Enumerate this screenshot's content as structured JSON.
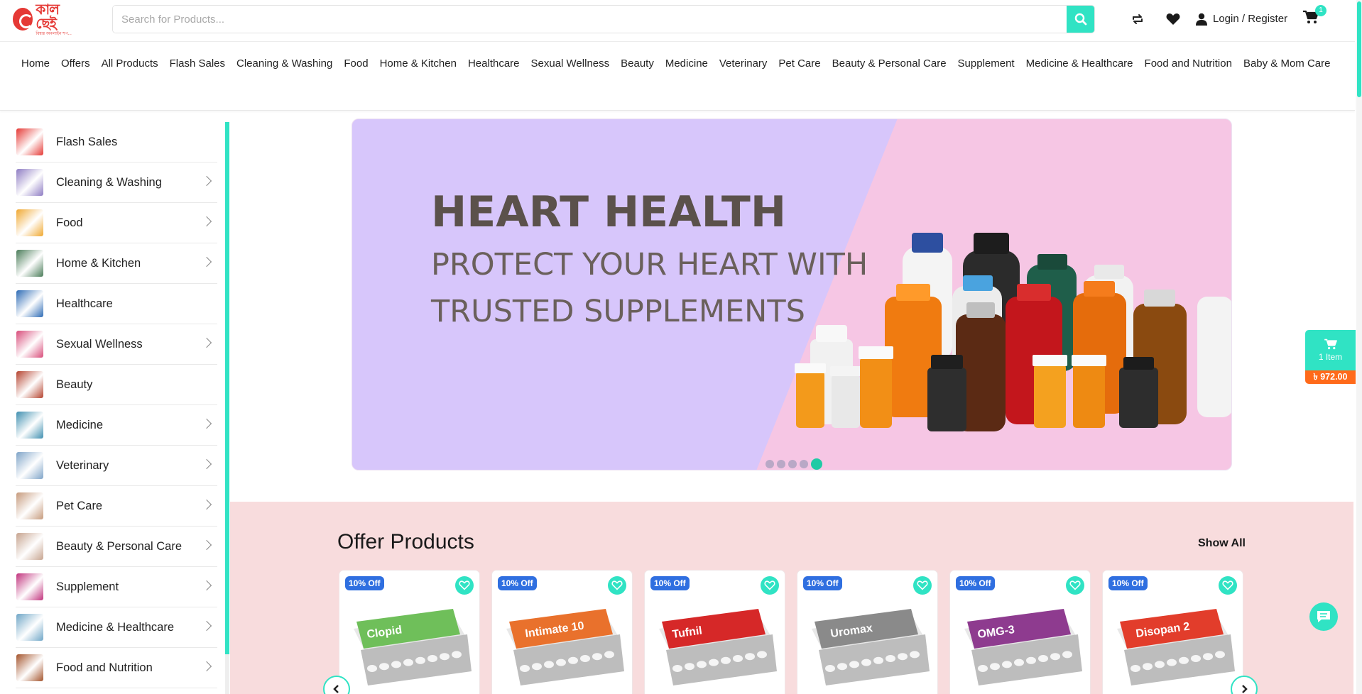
{
  "header": {
    "logo_text": "কাল ছেই",
    "logo_tagline": "বিশ্বস্ত অনলাইন শপ...",
    "search_placeholder": "Search for Products...",
    "login_label": "Login / Register",
    "cart_count": "1",
    "icons": [
      "compare-icon",
      "heart-icon",
      "user-icon",
      "cart-icon",
      "search-icon"
    ]
  },
  "nav": {
    "items": [
      "Home",
      "Offers",
      "All Products",
      "Flash Sales",
      "Cleaning & Washing",
      "Food",
      "Home & Kitchen",
      "Healthcare",
      "Sexual Wellness",
      "Beauty",
      "Medicine",
      "Veterinary",
      "Pet Care",
      "Beauty & Personal Care",
      "Supplement",
      "Medicine & Healthcare",
      "Food and Nutrition",
      "Baby & Mom Care"
    ]
  },
  "sidebar": {
    "items": [
      {
        "label": "Flash Sales",
        "has_children": false,
        "color": "#e53935"
      },
      {
        "label": "Cleaning & Washing",
        "has_children": true,
        "color": "#8e7cc3"
      },
      {
        "label": "Food",
        "has_children": true,
        "color": "#f0a830"
      },
      {
        "label": "Home & Kitchen",
        "has_children": true,
        "color": "#4a7c59"
      },
      {
        "label": "Healthcare",
        "has_children": false,
        "color": "#2d6bb5"
      },
      {
        "label": "Sexual Wellness",
        "has_children": true,
        "color": "#d84c7a"
      },
      {
        "label": "Beauty",
        "has_children": false,
        "color": "#b5432f"
      },
      {
        "label": "Medicine",
        "has_children": true,
        "color": "#3f8fb0"
      },
      {
        "label": "Veterinary",
        "has_children": true,
        "color": "#7fa4c8"
      },
      {
        "label": "Pet Care",
        "has_children": true,
        "color": "#c69a7c"
      },
      {
        "label": "Beauty & Personal Care",
        "has_children": true,
        "color": "#c7a48f"
      },
      {
        "label": "Supplement",
        "has_children": true,
        "color": "#c1337d"
      },
      {
        "label": "Medicine & Healthcare",
        "has_children": true,
        "color": "#6fa6c7"
      },
      {
        "label": "Food and Nutrition",
        "has_children": true,
        "color": "#a4542c"
      }
    ]
  },
  "banner": {
    "title": "HEART HEALTH",
    "subtitle_line1": "PROTECT YOUR HEART WITH",
    "subtitle_line2": "TRUSTED SUPPLEMENTS",
    "slide_count": 5,
    "active_slide": 5
  },
  "offer_section": {
    "title": "Offer Products",
    "show_all_label": "Show All",
    "products": [
      {
        "badge": "10% Off",
        "brand": "Clopid",
        "color": "#6fbf5a"
      },
      {
        "badge": "10% Off",
        "brand": "Intimate 10",
        "color": "#e9712c"
      },
      {
        "badge": "10% Off",
        "brand": "Tufnil",
        "color": "#d62828"
      },
      {
        "badge": "10% Off",
        "brand": "Uromax",
        "color": "#8a8a8a"
      },
      {
        "badge": "10% Off",
        "brand": "OMG-3",
        "color": "#8e3b8f"
      },
      {
        "badge": "10% Off",
        "brand": "Disopan 2",
        "color": "#e23d2b"
      }
    ]
  },
  "floating_cart": {
    "items_label": "1 Item",
    "total": "৳ 972.00"
  },
  "colors": {
    "accent": "#30e3c4",
    "badge": "#2f6fe0",
    "price": "#ff6a1a",
    "offer_bg": "#f8dcdd"
  }
}
